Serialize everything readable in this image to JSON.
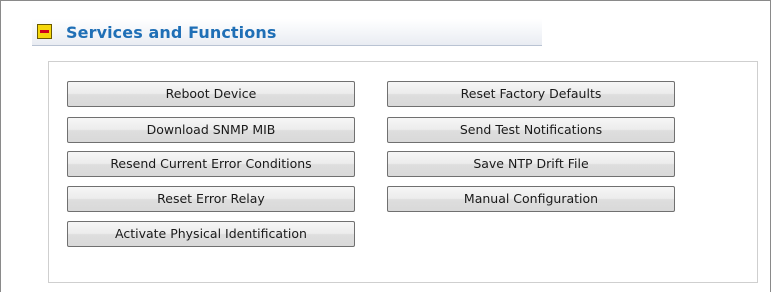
{
  "section": {
    "title": "Services and Functions",
    "toggle_icon": "minus-icon",
    "toggle_colors": {
      "fill": "#f6d70c",
      "mark": "#d0021b"
    },
    "title_color": "#1f6fb6"
  },
  "buttons": {
    "reboot_device": "Reboot Device",
    "download_snmp_mib": "Download SNMP MIB",
    "resend_error_conditions": "Resend Current Error Conditions",
    "reset_error_relay": "Reset Error Relay",
    "activate_physical_identification": "Activate Physical Identification",
    "reset_factory_defaults": "Reset Factory Defaults",
    "send_test_notifications": "Send Test Notifications",
    "save_ntp_drift_file": "Save NTP Drift File",
    "manual_configuration": "Manual Configuration"
  }
}
